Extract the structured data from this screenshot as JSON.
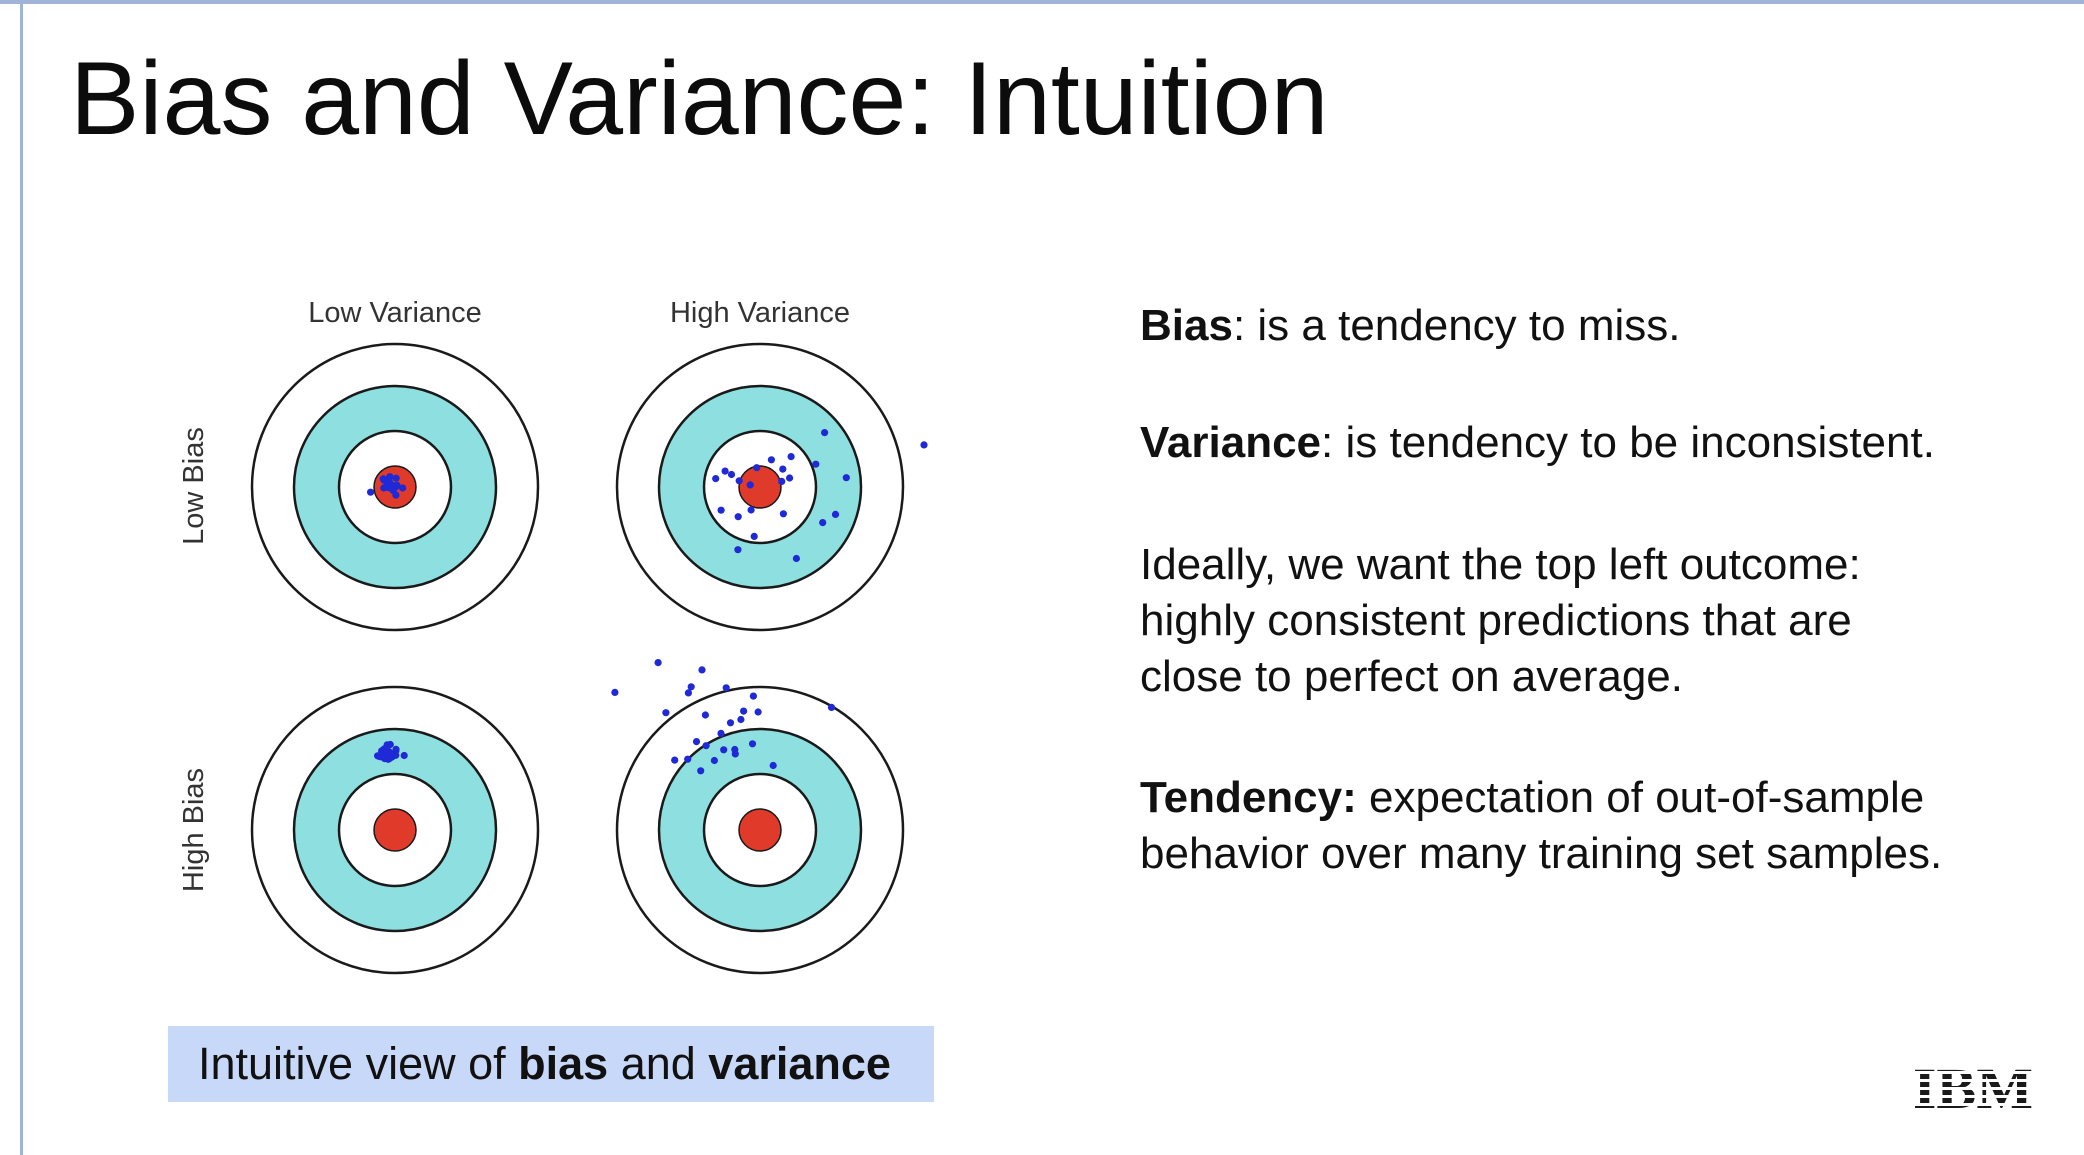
{
  "slide": {
    "title": "Bias and Variance: Intuition",
    "figure": {
      "column_labels": [
        "Low Variance",
        "High Variance"
      ],
      "row_labels": [
        "Low Bias",
        "High Bias"
      ],
      "colors": {
        "ring_fill": "#8ee0e0",
        "bullseye": "#e03a2a",
        "hit": "#1f2ad6",
        "ring_stroke": "#1a1a1a"
      }
    },
    "caption": {
      "prefix": "Intuitive view of ",
      "bold1": "bias",
      "middle": " and ",
      "bold2": "variance"
    },
    "definitions": {
      "bias_term": "Bias",
      "bias_text": ": is a tendency to miss.",
      "variance_term": "Variance",
      "variance_text": ": is tendency to be inconsistent.",
      "ideal_lines": [
        "Ideally, we want the top left outcome:",
        "highly consistent predictions that are",
        "close to perfect on average."
      ],
      "tendency_term": "Tendency:",
      "tendency_line1": " expectation of out-of-sample",
      "tendency_line2": "behavior over many training set samples."
    },
    "logo_text": "IBM",
    "logo_color": "#1a1a1a"
  }
}
